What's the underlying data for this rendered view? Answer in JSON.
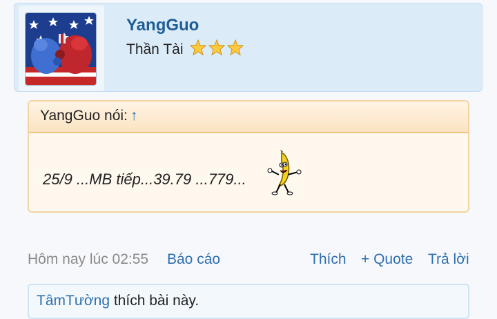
{
  "user": {
    "name": "YangGuo",
    "title": "Thần Tài",
    "rank_stars": 3
  },
  "quote": {
    "author_label": "YangGuo nói:",
    "arrow": "↑",
    "text": "25/9 ...MB tiếp...39.79 ...779..."
  },
  "meta": {
    "date": "Hôm nay lúc 02:55",
    "report": "Báo cáo",
    "like": "Thích",
    "quote": "+ Quote",
    "reply": "Trả lời"
  },
  "likes": {
    "liker": "TâmTường",
    "suffix": " thích bài này."
  },
  "colors": {
    "accent": "#2e6fae",
    "username": "#1f5d96",
    "card_bg": "#dcebf8",
    "quote_border": "#f2c57f"
  }
}
